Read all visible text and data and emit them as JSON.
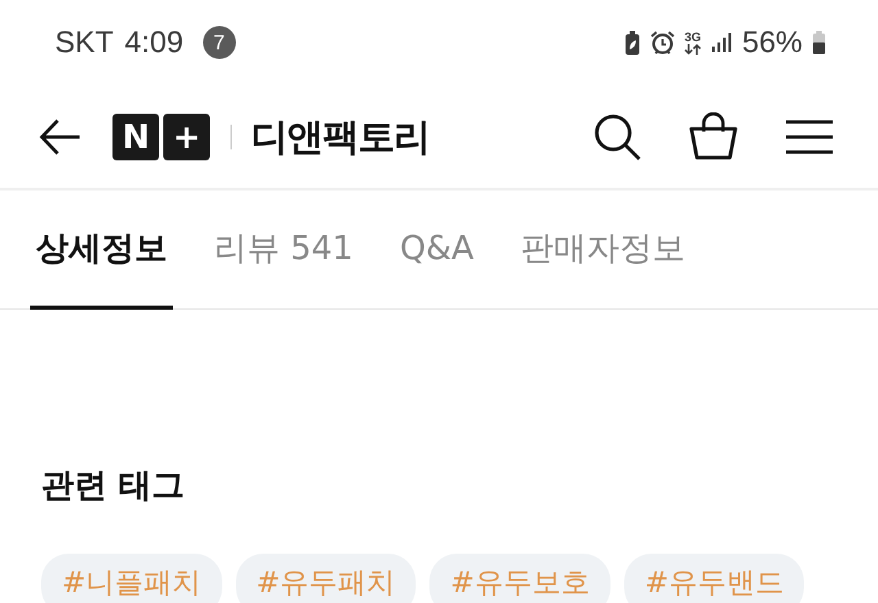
{
  "status_bar": {
    "carrier": "SKT",
    "time": "4:09",
    "notification_count": "7",
    "network": "3G",
    "battery": "56%"
  },
  "header": {
    "logo_mark": [
      "N",
      "+"
    ],
    "store_name": "디앤팩토리"
  },
  "tabs": [
    {
      "label": "상세정보",
      "selected": true
    },
    {
      "label": "리뷰 541",
      "selected": false
    },
    {
      "label": "Q&A",
      "selected": false
    },
    {
      "label": "판매자정보",
      "selected": false
    }
  ],
  "related_tags": {
    "title": "관련 태그",
    "tags": [
      "#니플패치",
      "#유두패치",
      "#유두보호",
      "#유두밴드"
    ]
  }
}
